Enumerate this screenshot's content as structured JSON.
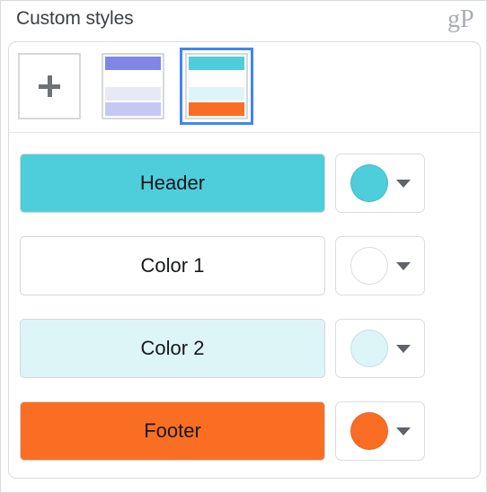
{
  "header": {
    "title": "Custom styles",
    "watermark": "gP"
  },
  "swatch_strip": {
    "add_button": {
      "label": "+",
      "icon": "plus-icon"
    },
    "styles": [
      {
        "name": "purple-style",
        "selected": false,
        "bands": [
          "#8085e8",
          "#ffffff",
          "#e8e9f5",
          "#c5c7f5"
        ]
      },
      {
        "name": "teal-orange-style",
        "selected": true,
        "bands": [
          "#4ecddb",
          "#ffffff",
          "#def5f8",
          "#fa6e23"
        ]
      }
    ],
    "selection_color": "#4285f4"
  },
  "color_rows": [
    {
      "label": "Header",
      "fill": "#4ecddb",
      "circle": "#4ecddb",
      "hollow": false,
      "caret_icon": "chevron-down-icon"
    },
    {
      "label": "Color 1",
      "fill": "#ffffff",
      "circle": "#ffffff",
      "hollow": true,
      "caret_icon": "chevron-down-icon"
    },
    {
      "label": "Color 2",
      "fill": "#def5f8",
      "circle": "#def5f8",
      "hollow": false,
      "caret_icon": "chevron-down-icon"
    },
    {
      "label": "Footer",
      "fill": "#fa6e23",
      "circle": "#fa6e23",
      "hollow": false,
      "caret_icon": "chevron-down-icon"
    }
  ]
}
